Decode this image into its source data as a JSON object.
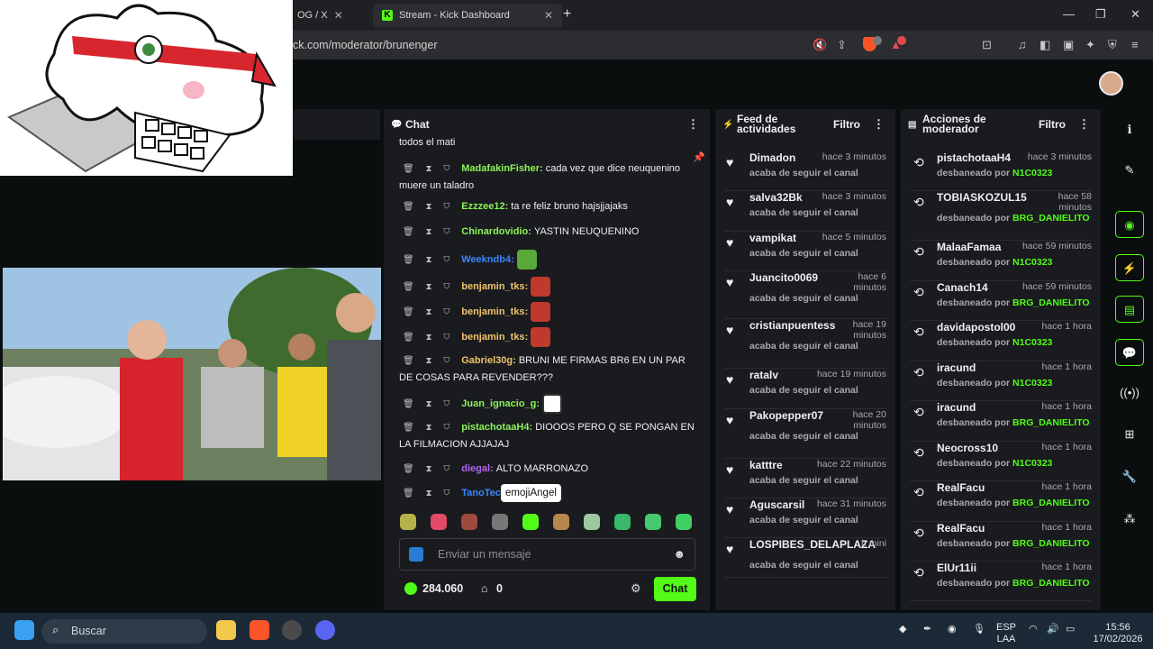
{
  "browser": {
    "tab1_title": "OG / X",
    "tab2_title": "Stream - Kick Dashboard",
    "url": "ck.com/moderator/brunenger"
  },
  "chat": {
    "title": "Chat",
    "top_text": "todos el mati",
    "messages": [
      {
        "user": "MadafakinFisher",
        "color": "#8cf35a",
        "text": "cada vez que dice neuquenino muere un taladro"
      },
      {
        "user": "Ezzzee12",
        "color": "#8cf35a",
        "text": "ta re feliz bruno hajsjjajaks"
      },
      {
        "user": "Chinardovidio",
        "color": "#8cf35a",
        "text": "YASTIN NEUQUENINO"
      },
      {
        "user": "Weekndb4",
        "color": "#3a86ff",
        "text": ""
      },
      {
        "user": "benjamin_tks",
        "color": "#f0c36a",
        "text": ""
      },
      {
        "user": "benjamin_tks",
        "color": "#f0c36a",
        "text": ""
      },
      {
        "user": "benjamin_tks",
        "color": "#f0c36a",
        "text": ""
      },
      {
        "user": "Gabriel30g",
        "color": "#f0c36a",
        "text": "BRUNI ME FIRMAS BR6 EN UN PAR DE COSAS PARA REVENDER???"
      },
      {
        "user": "Juan_ignacio_g",
        "color": "#8cf35a",
        "text": ""
      },
      {
        "user": "pistachotaaH4",
        "color": "#8cf35a",
        "text": "DIOOOS PERO Q SE PONGAN EN LA FILMACION AJJAJAJ"
      },
      {
        "user": "diegal",
        "color": "#b565f2",
        "text": "ALTO MARRONAZO"
      },
      {
        "user": "TanoTec",
        "color": "#3a86ff",
        "text": ""
      }
    ],
    "tooltip": "emojiAngel",
    "input_placeholder": "Enviar un mensaje",
    "points": "284.060",
    "store_count": "0",
    "send_label": "Chat"
  },
  "feed": {
    "title": "Feed de actividades",
    "filter": "Filtro",
    "items": [
      {
        "name": "Dimadon",
        "time": "hace 3 minutos",
        "sub": "acaba de seguir el canal"
      },
      {
        "name": "salva32Bk",
        "time": "hace 3 minutos",
        "sub": "acaba de seguir el canal"
      },
      {
        "name": "vampikat",
        "time": "hace 5 minutos",
        "sub": "acaba de seguir el canal"
      },
      {
        "name": "Juancito0069",
        "time": "hace 6 minutos",
        "sub": "acaba de seguir el canal"
      },
      {
        "name": "cristianpuentess",
        "time": "hace 19 minutos",
        "sub": "acaba de seguir el canal"
      },
      {
        "name": "ratalv",
        "time": "hace 19 minutos",
        "sub": "acaba de seguir el canal"
      },
      {
        "name": "Pakopepper07",
        "time": "hace 20 minutos",
        "sub": "acaba de seguir el canal"
      },
      {
        "name": "katttre",
        "time": "hace 22 minutos",
        "sub": "acaba de seguir el canal"
      },
      {
        "name": "Aguscarsil",
        "time": "hace 31 minutos",
        "sub": "acaba de seguir el canal"
      },
      {
        "name": "LOSPIBES_DELAPLAZA",
        "time": "h mini",
        "sub": "acaba de seguir el canal"
      }
    ]
  },
  "mod": {
    "title": "Acciones de moderador",
    "filter": "Filtro",
    "action": "desbaneado por",
    "items": [
      {
        "name": "pistachotaaH4",
        "time": "hace 3 minutos",
        "by": "N1C0323"
      },
      {
        "name": "TOBIASKOZUL15",
        "time": "hace 58 minutos",
        "by": "BRG_DANIELITO"
      },
      {
        "name": "MalaaFamaa",
        "time": "hace 59 minutos",
        "by": "N1C0323"
      },
      {
        "name": "Canach14",
        "time": "hace 59 minutos",
        "by": "BRG_DANIELITO"
      },
      {
        "name": "davidapostol00",
        "time": "hace 1 hora",
        "by": "N1C0323"
      },
      {
        "name": "iracund",
        "time": "hace 1 hora",
        "by": "N1C0323"
      },
      {
        "name": "iracund",
        "time": "hace 1 hora",
        "by": "BRG_DANIELITO"
      },
      {
        "name": "Neocross10",
        "time": "hace 1 hora",
        "by": "N1C0323"
      },
      {
        "name": "RealFacu",
        "time": "hace 1 hora",
        "by": "BRG_DANIELITO"
      },
      {
        "name": "RealFacu",
        "time": "hace 1 hora",
        "by": "BRG_DANIELITO"
      },
      {
        "name": "ElUr11ii",
        "time": "hace 1 hora",
        "by": "BRG_DANIELITO"
      }
    ]
  },
  "taskbar": {
    "search": "Buscar",
    "lang1": "ESP",
    "lang2": "LAA",
    "time": "15:56",
    "date": "17/02/2026"
  },
  "colors": {
    "accent": "#53fc18",
    "panel": "#191b1f",
    "background": "#0b0e0f"
  }
}
